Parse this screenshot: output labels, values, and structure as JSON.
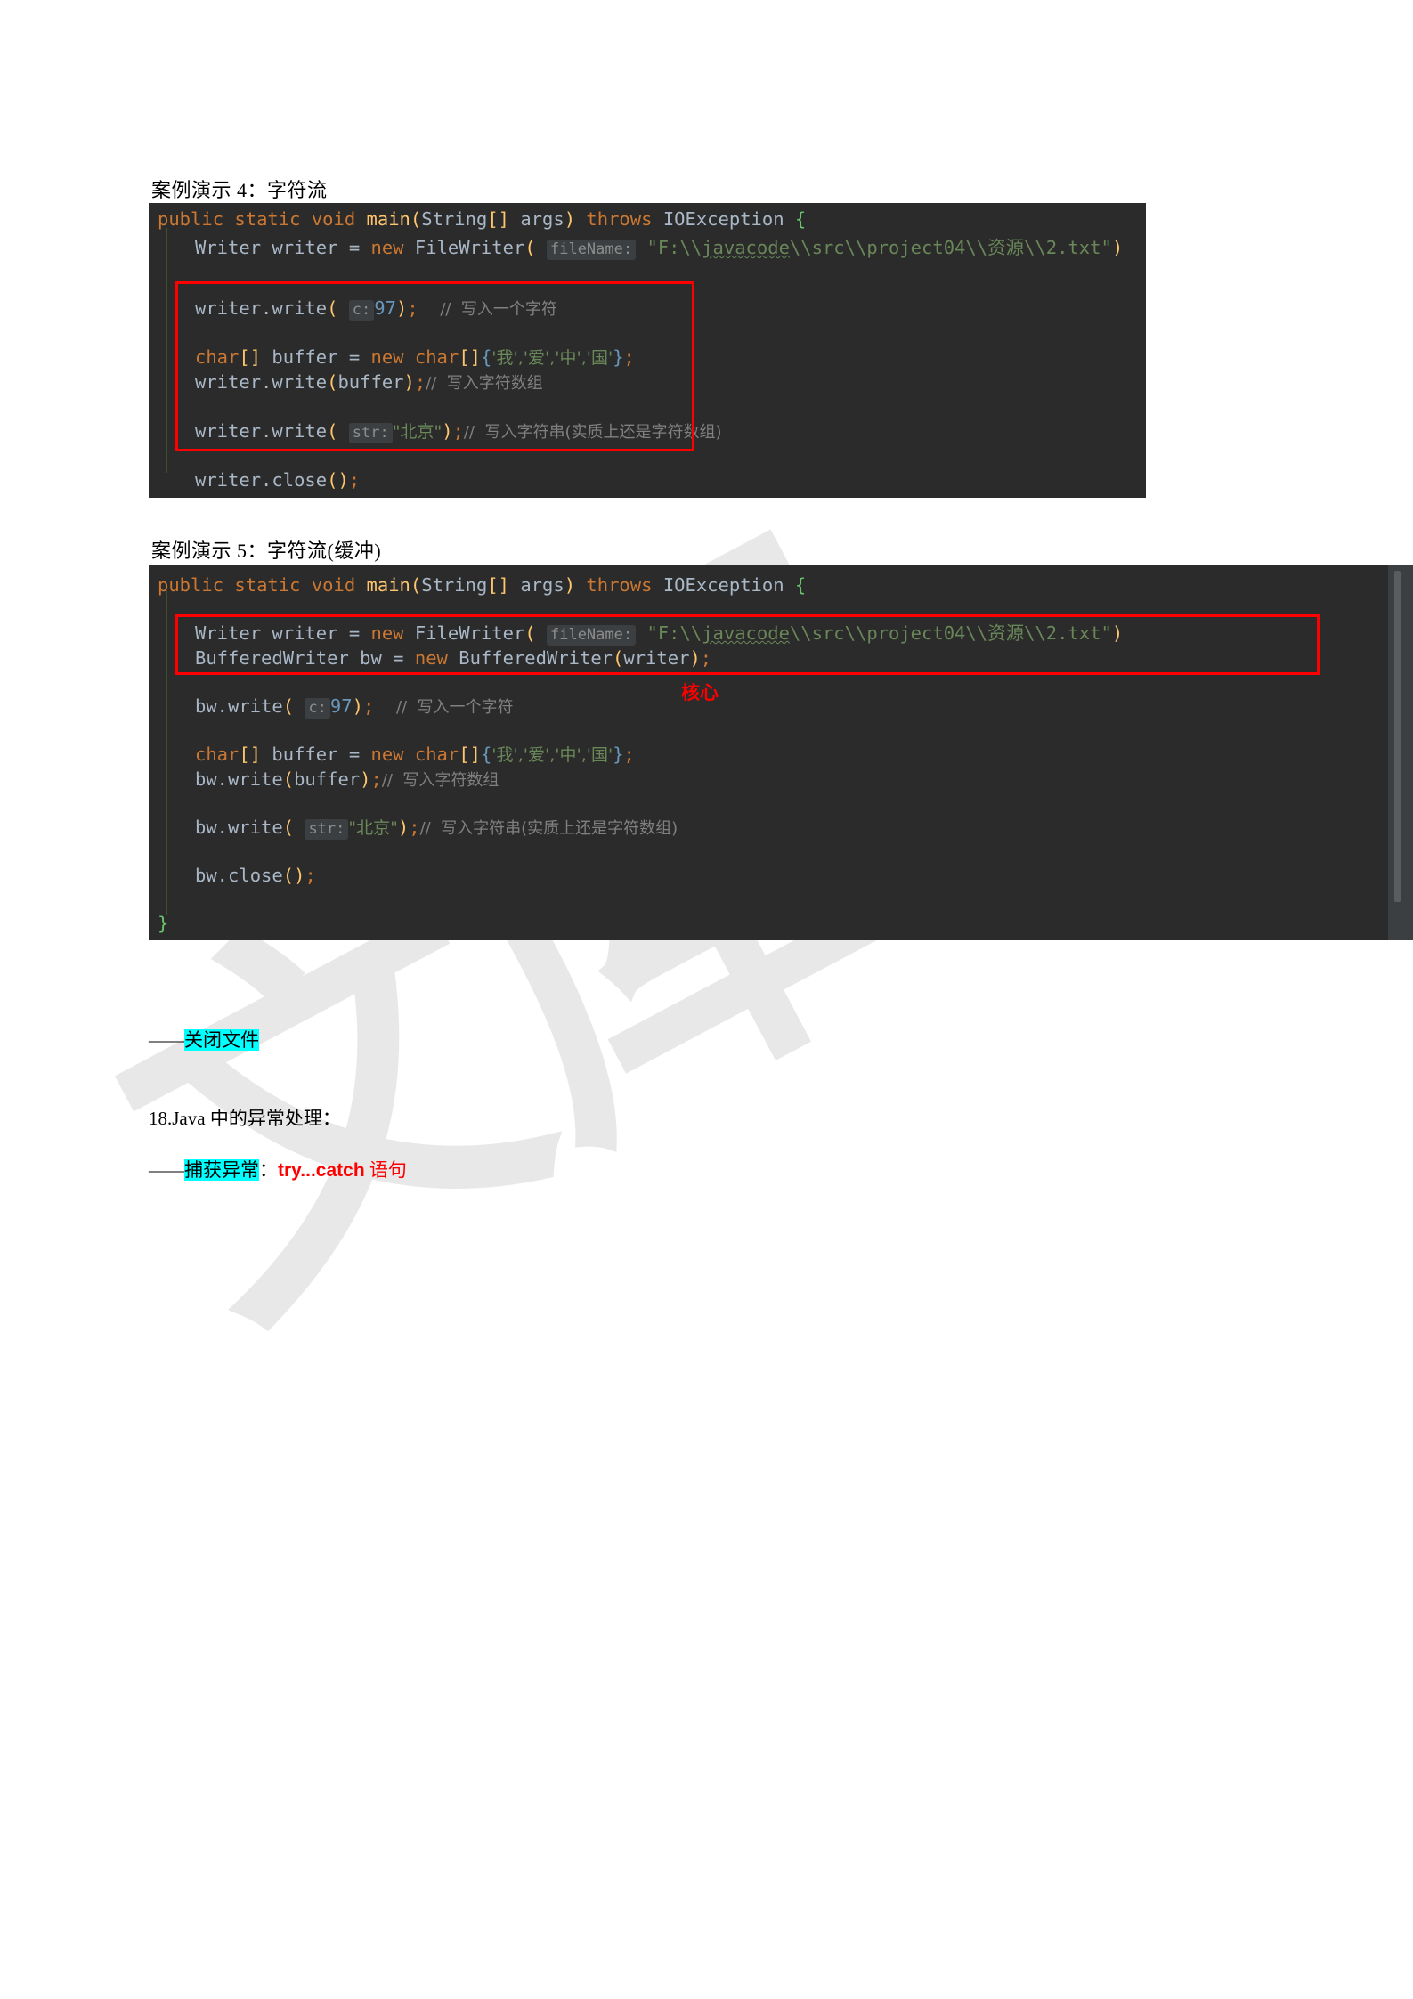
{
  "document": {
    "background_color": "#ffffff",
    "code_background": "#2b2b2b",
    "highlight_color": "#00ffff",
    "annotation_color": "#ff0000"
  },
  "sections": {
    "caption4": "案例演示 4：字符流",
    "caption5": "案例演示 5：字符流(缓冲)"
  },
  "code_block_1": {
    "line1": {
      "kw_public": "public",
      "kw_static": "static",
      "kw_void": "void",
      "method": "main",
      "paren_open": "(",
      "type_string": "String",
      "bracket": "[]",
      "arg": "args",
      "paren_close": ")",
      "kw_throws": "throws",
      "exception": "IOException",
      "brace": "{"
    },
    "line2": {
      "type": "Writer",
      "var": "writer",
      "eq": "=",
      "kw_new": "new",
      "ctor": "FileWriter",
      "paren_open": "(",
      "hint": "fileName:",
      "path_pre": "\"F:\\\\",
      "path_squiggle": "javacode",
      "path_post": "\\\\src\\\\project04\\\\资源\\\\2.txt\"",
      "paren_close": ")"
    },
    "line3": {
      "call": "writer.write",
      "paren_open": "(",
      "hint": "c:",
      "value": "97",
      "paren_close": ")",
      "semi": ";",
      "comment": "//  写入一个字符"
    },
    "line4": {
      "kw_char": "char",
      "bracket": "[]",
      "var": "buffer",
      "eq": "=",
      "kw_new": "new",
      "type_char": "char",
      "bracket2": "[]",
      "curly_open": "{",
      "chars": "'我','爱','中','国'",
      "curly_close": "}",
      "semi": ";"
    },
    "line5": {
      "call": "writer.write",
      "paren_open": "(",
      "arg": "buffer",
      "paren_close": ")",
      "semi": ";",
      "comment": "//  写入字符数组"
    },
    "line6": {
      "call": "writer.write",
      "paren_open": "(",
      "hint": "str:",
      "value": "\"北京\"",
      "paren_close": ")",
      "semi": ";",
      "comment": "//  写入字符串(实质上还是字符数组)"
    },
    "line7": {
      "call": "writer.close",
      "parens": "()",
      "semi": ";"
    },
    "line8": {
      "brace": "}"
    }
  },
  "code_block_2": {
    "line1": {
      "kw_public": "public",
      "kw_static": "static",
      "kw_void": "void",
      "method": "main",
      "paren_open": "(",
      "type_string": "String",
      "bracket": "[]",
      "arg": "args",
      "paren_close": ")",
      "kw_throws": "throws",
      "exception": "IOException",
      "brace": "{"
    },
    "line2": {
      "type": "Writer",
      "var": "writer",
      "eq": "=",
      "kw_new": "new",
      "ctor": "FileWriter",
      "paren_open": "(",
      "hint": "fileName:",
      "path_pre": "\"F:\\\\",
      "path_squiggle": "javacode",
      "path_post": "\\\\src\\\\project04\\\\资源\\\\2.txt\"",
      "paren_close": ")"
    },
    "line3": {
      "type": "BufferedWriter",
      "var": "bw",
      "eq": "=",
      "kw_new": "new",
      "ctor": "BufferedWriter",
      "paren_open": "(",
      "arg": "writer",
      "paren_close": ")",
      "semi": ";"
    },
    "line4": {
      "call": "bw.write",
      "paren_open": "(",
      "hint": "c:",
      "value": "97",
      "paren_close": ")",
      "semi": ";",
      "comment": "//  写入一个字符"
    },
    "line5": {
      "kw_char": "char",
      "bracket": "[]",
      "var": "buffer",
      "eq": "=",
      "kw_new": "new",
      "type_char": "char",
      "bracket2": "[]",
      "curly_open": "{",
      "chars": "'我','爱','中','国'",
      "curly_close": "}",
      "semi": ";"
    },
    "line6": {
      "call": "bw.write",
      "paren_open": "(",
      "arg": "buffer",
      "paren_close": ")",
      "semi": ";",
      "comment": "//  写入字符数组"
    },
    "line7": {
      "call": "bw.write",
      "paren_open": "(",
      "hint": "str:",
      "value": "\"北京\"",
      "paren_close": ")",
      "semi": ";",
      "comment": "//  写入字符串(实质上还是字符数组)"
    },
    "line8": {
      "call": "bw.close",
      "parens": "()",
      "semi": ";"
    },
    "line9": {
      "brace": "}"
    },
    "annotation": "核心"
  },
  "notes": {
    "close_file": {
      "dash": "——",
      "highlight": "关闭文件"
    },
    "exception_heading": "18.Java 中的异常处理：",
    "catch_exception": {
      "dash": "——",
      "highlight": "捕获异常",
      "colon": "：",
      "keyword": "try...catch",
      "suffix": " 语句"
    }
  }
}
